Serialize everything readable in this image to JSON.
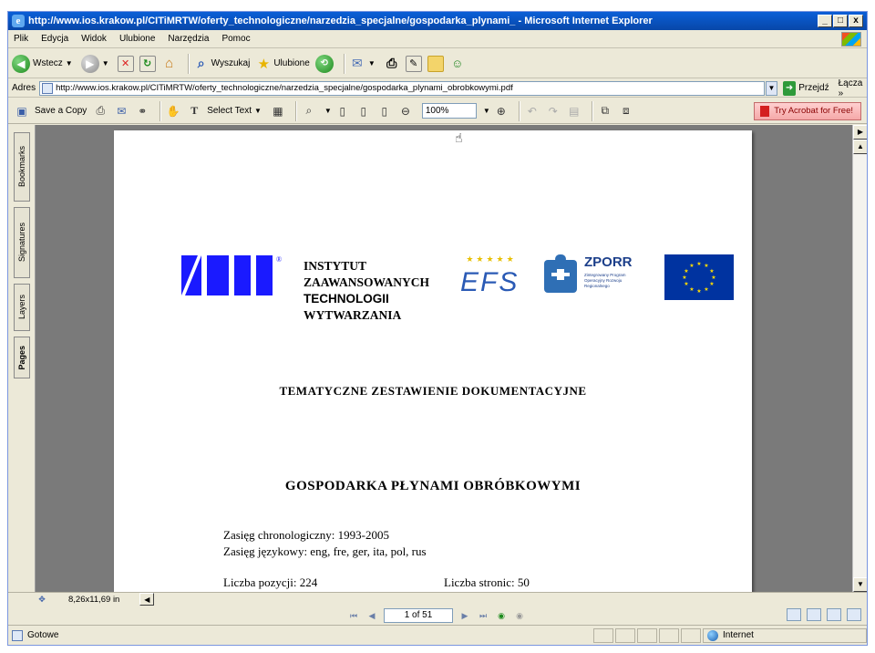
{
  "window": {
    "title": "http://www.ios.krakow.pl/CITiMRTW/oferty_technologiczne/narzedzia_specjalne/gospodarka_plynami_ - Microsoft Internet Explorer",
    "min_glyph": "_",
    "max_glyph": "□",
    "close_glyph": "x"
  },
  "menu": [
    "Plik",
    "Edycja",
    "Widok",
    "Ulubione",
    "Narzędzia",
    "Pomoc"
  ],
  "toolbar": {
    "back_label": "Wstecz",
    "search_label": "Wyszukaj",
    "favorites_label": "Ulubione"
  },
  "address": {
    "label": "Adres",
    "url": "http://www.ios.krakow.pl/CITiMRTW/oferty_technologiczne/narzedzia_specjalne/gospodarka_plynami_obrobkowymi.pdf",
    "go_label": "Przejdź",
    "links_label": "Łącza »"
  },
  "acrobat": {
    "save_copy_label": "Save a Copy",
    "select_text_label": "Select Text",
    "zoom_value": "100%",
    "try_acrobat_label": "Try Acrobat for Free!"
  },
  "side_tabs": [
    "Bookmarks",
    "Signatures",
    "Layers",
    "Pages"
  ],
  "document": {
    "institute_name": [
      "INSTYTUT",
      "ZAAWANSOWANYCH",
      "TECHNOLOGII",
      "WYTWARZANIA"
    ],
    "logo_ios_text": "IOS",
    "logo_efs_text": "EFS",
    "logo_zporr_text": "ZPORR",
    "logo_zporr_sub": "Zintegrowany Program Operacyjny Rozwoju Regionalnego",
    "heading": "TEMATYCZNE  ZESTAWIENIE  DOKUMENTACYJNE",
    "title": "GOSPODARKA  PŁYNAMI  OBRÓBKOWYMI",
    "chronological_range": "Zasięg chronologiczny: 1993-2005",
    "language_range": "Zasięg językowy: eng, fre, ger, ita, pol, rus",
    "item_count": "Liczba pozycji: 224",
    "page_count": "Liczba stronic: 50"
  },
  "pdf_nav": {
    "page_size": "8,26x11,69 in",
    "page_indicator": "1 of 51"
  },
  "status": {
    "text": "Gotowe",
    "zone": "Internet"
  }
}
